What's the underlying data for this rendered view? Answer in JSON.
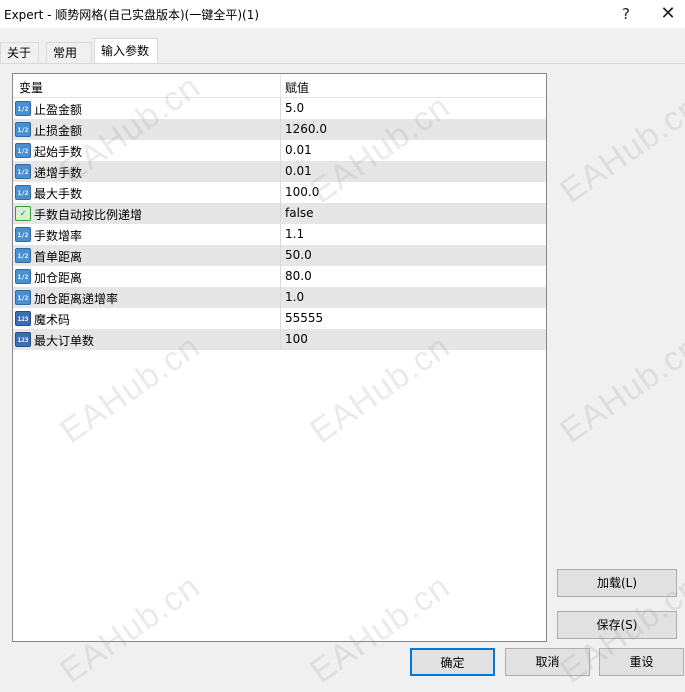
{
  "window": {
    "title": "Expert - 顺势网格(自己实盘版本)(一键全平)(1)",
    "help_glyph": "?",
    "close_glyph": "✕"
  },
  "tabs": [
    {
      "label": "关于"
    },
    {
      "label": "常用"
    },
    {
      "label": "输入参数",
      "active": true
    }
  ],
  "grid": {
    "headers": {
      "variable": "变量",
      "value": "赋值"
    },
    "rows": [
      {
        "icon": "double-type-icon",
        "icon_text": "1/2",
        "name": "止盈金额",
        "value": "5.0"
      },
      {
        "icon": "double-type-icon",
        "icon_text": "1/2",
        "name": "止损金额",
        "value": "1260.0"
      },
      {
        "icon": "double-type-icon",
        "icon_text": "1/2",
        "name": "起始手数",
        "value": "0.01"
      },
      {
        "icon": "double-type-icon",
        "icon_text": "1/2",
        "name": "递增手数",
        "value": "0.01"
      },
      {
        "icon": "double-type-icon",
        "icon_text": "1/2",
        "name": "最大手数",
        "value": "100.0"
      },
      {
        "icon": "bool-type-icon",
        "icon_text": "✓",
        "name": "手数自动按比例递增",
        "value": "false"
      },
      {
        "icon": "double-type-icon",
        "icon_text": "1/2",
        "name": "手数增率",
        "value": "1.1"
      },
      {
        "icon": "double-type-icon",
        "icon_text": "1/2",
        "name": "首单距离",
        "value": "50.0"
      },
      {
        "icon": "double-type-icon",
        "icon_text": "1/2",
        "name": "加仓距离",
        "value": "80.0"
      },
      {
        "icon": "double-type-icon",
        "icon_text": "1/2",
        "name": "加仓距离递增率",
        "value": "1.0"
      },
      {
        "icon": "int-type-icon",
        "icon_text": "123",
        "name": "魔术码",
        "value": "55555"
      },
      {
        "icon": "int-type-icon",
        "icon_text": "123",
        "name": "最大订单数",
        "value": "100"
      }
    ]
  },
  "buttons": {
    "load": "加载(L)",
    "save": "保存(S)",
    "ok": "确定",
    "cancel": "取消",
    "reset": "重设"
  },
  "watermark": "EAHub.cn"
}
